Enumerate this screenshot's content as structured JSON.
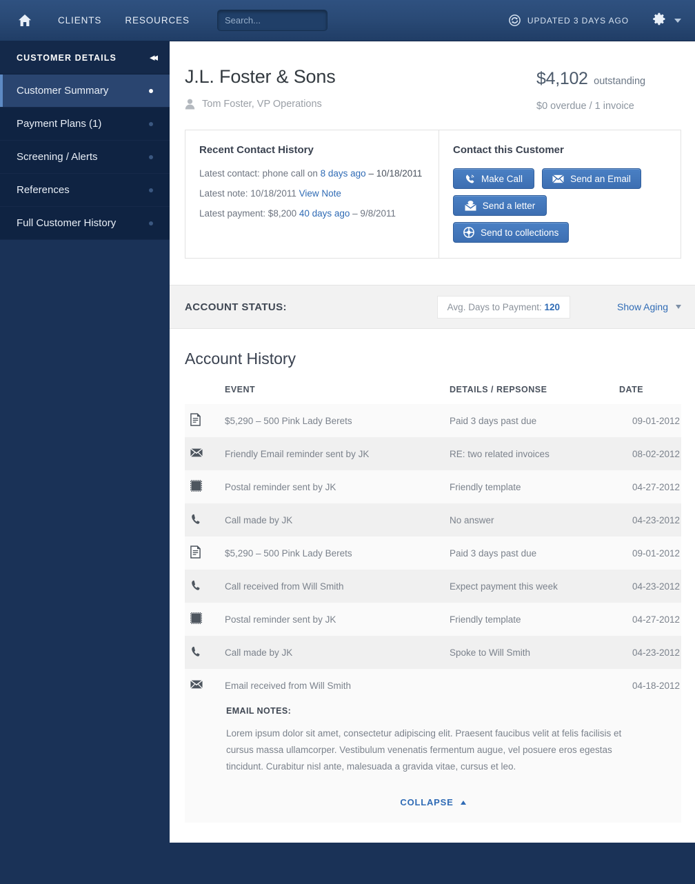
{
  "topbar": {
    "home_icon": "home-icon",
    "nav": [
      {
        "label": "CLIENTS"
      },
      {
        "label": "RESOURCES"
      }
    ],
    "search": {
      "value": "",
      "placeholder": "Search..."
    },
    "updated_text": "UPDATED 3 DAYS AGO",
    "refresh_icon": "refresh-icon",
    "gear_icon": "gear-icon",
    "caret_icon": "chevron-down-icon",
    "colors": {
      "gradient_top": "#2f5180",
      "gradient_bottom": "#203d66"
    }
  },
  "sidebar": {
    "title": "CUSTOMER DETAILS",
    "collapse_icon": "double-chevron-left-icon",
    "items": [
      {
        "label": "Customer Summary",
        "active": true
      },
      {
        "label": "Payment Plans (1)",
        "active": false
      },
      {
        "label": "Screening / Alerts",
        "active": false
      },
      {
        "label": "References",
        "active": false
      },
      {
        "label": "Full Customer History",
        "active": false
      }
    ],
    "colors": {
      "header_bg": "#14294a",
      "list_bg": "#0f2342",
      "active_bg": "#2a4570"
    }
  },
  "customer": {
    "name": "J.L. Foster & Sons",
    "contact_icon": "person-icon",
    "contact_person": "Tom Foster, VP Operations",
    "outstanding_amount": "$4,102",
    "outstanding_label": "outstanding",
    "overdue_summary": "$0 overdue / 1 invoice"
  },
  "recent_contact": {
    "title": "Recent Contact History",
    "rows": [
      {
        "prefix": "Latest contact: phone call on ",
        "link": "8 days ago",
        "suffix": " – 10/18/2011"
      },
      {
        "prefix": "Latest note: 10/18/2011 ",
        "link": "View Note",
        "suffix": ""
      },
      {
        "prefix": "Latest payment: $8,200 ",
        "link": "40 days ago",
        "suffix": " – 9/8/2011"
      }
    ]
  },
  "contact_panel": {
    "title": "Contact this Customer",
    "buttons": [
      {
        "label": "Make Call",
        "icon": "phone-icon"
      },
      {
        "label": "Send an Email",
        "icon": "envelope-icon"
      },
      {
        "label": "Send a letter",
        "icon": "letter-icon"
      },
      {
        "label": "Send to collections",
        "icon": "globe-target-icon"
      }
    ],
    "accent_color": "#3d6fb2"
  },
  "account_status": {
    "label": "ACCOUNT STATUS:",
    "avg_days_label": "Avg. Days to Payment:",
    "avg_days_value": "120",
    "show_aging_label": "Show Aging",
    "show_aging_caret": "chevron-down-icon"
  },
  "account_history": {
    "title": "Account History",
    "columns": {
      "icon": "",
      "event": "EVENT",
      "details": "DETAILS / REPSONSE",
      "date": "DATE"
    },
    "rows": [
      {
        "icon": "document-icon",
        "event": "$5,290 – 500 Pink Lady Berets",
        "details": "Paid 3 days past due",
        "date": "09-01-2012"
      },
      {
        "icon": "envelope-icon",
        "event": "Friendly Email reminder sent by JK",
        "details": "RE: two related invoices",
        "date": "08-02-2012"
      },
      {
        "icon": "stamp-icon",
        "event": "Postal reminder sent by JK",
        "details": "Friendly template",
        "date": "04-27-2012"
      },
      {
        "icon": "phone-icon",
        "event": "Call made by JK",
        "details": "No answer",
        "date": "04-23-2012"
      },
      {
        "icon": "document-icon",
        "event": "$5,290 – 500 Pink Lady Berets",
        "details": "Paid 3 days past due",
        "date": "09-01-2012"
      },
      {
        "icon": "phone-icon",
        "event": "Call received from Will Smith",
        "details": "Expect payment this week",
        "date": "04-23-2012"
      },
      {
        "icon": "stamp-icon",
        "event": "Postal reminder sent by JK",
        "details": "Friendly template",
        "date": "04-27-2012"
      },
      {
        "icon": "phone-icon",
        "event": "Call made by JK",
        "details": "Spoke to Will Smith",
        "date": "04-23-2012"
      },
      {
        "icon": "envelope-icon",
        "event": "Email received from Will Smith",
        "details": "",
        "date": "04-18-2012"
      }
    ],
    "email_notes": {
      "title": "EMAIL NOTES:",
      "body": "Lorem ipsum dolor sit amet, consectetur adipiscing elit. Praesent faucibus velit at felis facilisis et cursus massa ullamcorper. Vestibulum venenatis fermentum augue, vel posuere eros egestas tincidunt. Curabitur nisl ante, malesuada a gravida vitae, cursus et leo."
    },
    "collapse_label": "COLLAPSE",
    "collapse_icon": "chevron-up-icon"
  }
}
